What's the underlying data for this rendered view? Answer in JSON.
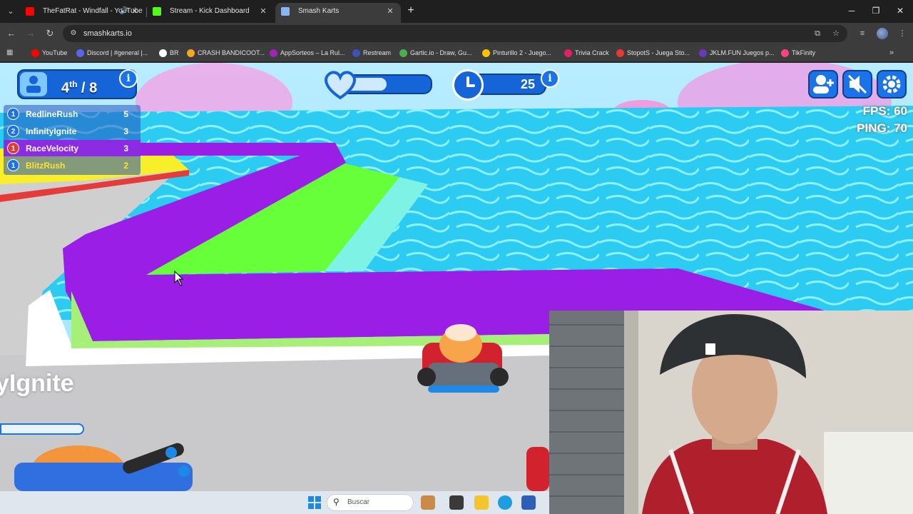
{
  "browser": {
    "tabs": [
      {
        "title": "TheFatRat - Windfall - YouTube",
        "favicon": "youtube-icon",
        "color": "#ff0000",
        "audio": true
      },
      {
        "title": "Stream - Kick Dashboard",
        "favicon": "kick-icon",
        "color": "#53fc18"
      },
      {
        "title": "Smash Karts",
        "favicon": "smash-karts-icon",
        "color": "#8ab4f8",
        "active": true
      }
    ],
    "address": "smashkarts.io",
    "bookmarks": [
      {
        "label": "YouTube",
        "color": "#ff0000"
      },
      {
        "label": "Discord | #general |...",
        "color": "#5865f2"
      },
      {
        "label": "BR",
        "color": "#ffffff"
      },
      {
        "label": "CRASH BANDICOOT...",
        "color": "#f5a623"
      },
      {
        "label": "AppSorteos – La Rul...",
        "color": "#9c27b0"
      },
      {
        "label": "Restream",
        "color": "#3f51b5"
      },
      {
        "label": "Gartic.io - Draw, Gu...",
        "color": "#4caf50"
      },
      {
        "label": "Pinturillo 2 - Juego...",
        "color": "#ffc107"
      },
      {
        "label": "Trivia Crack",
        "color": "#e91e63"
      },
      {
        "label": "StopotS - Juega Sto...",
        "color": "#e53935"
      },
      {
        "label": "JKLM.FUN Juegos p...",
        "color": "#673ab7"
      },
      {
        "label": "TikFinity",
        "color": "#ff4081"
      }
    ]
  },
  "hud": {
    "position": "4",
    "position_suffix": "th",
    "position_total": "/ 8",
    "health_fraction": 0.5,
    "timer": "25",
    "fps": "FPS: 60",
    "ping": "PING: 70",
    "buttons": [
      "add-friend-icon",
      "mute-icon",
      "settings-icon"
    ]
  },
  "leaderboard": [
    {
      "rank": "1",
      "name": "RedlineRush",
      "score": "5",
      "rank_color": "#1a73e8"
    },
    {
      "rank": "2",
      "name": "InfinityIgnite",
      "score": "3",
      "rank_color": "#1a73e8"
    },
    {
      "rank": "1",
      "name": "RaceVelocity",
      "score": "3",
      "rank_color": "#e53935",
      "highlight": true
    },
    {
      "rank": "1",
      "name": "BlitzRush",
      "score": "2",
      "rank_color": "#1a73e8",
      "name_color": "#ffe135"
    }
  ],
  "game": {
    "nearby_player_label": "yIgnite"
  },
  "taskbar": {
    "search_placeholder": "Buscar"
  },
  "colors": {
    "track_purple": "#9b1ee6",
    "ramp_green": "#66ff3a",
    "water": "#33d4f5",
    "hud_blue": "#1565d8"
  }
}
